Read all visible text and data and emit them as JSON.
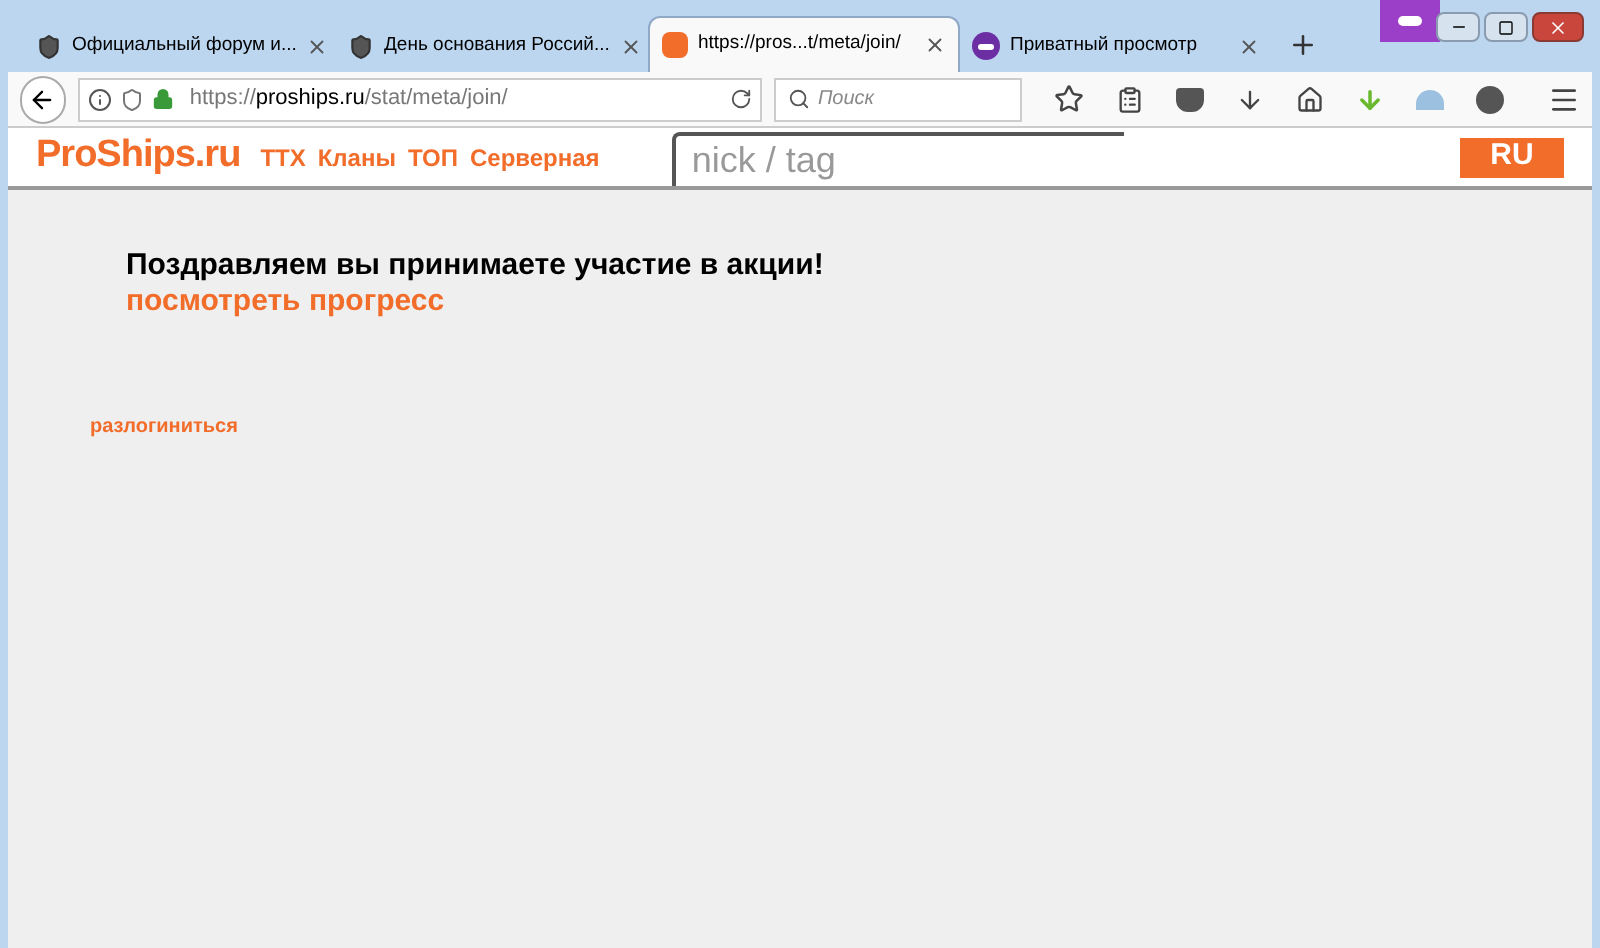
{
  "tabs": [
    {
      "title": "Официальный форум и...",
      "selected": false
    },
    {
      "title": "День основания Россий...",
      "selected": false
    },
    {
      "title": "https://pros...t/meta/join/",
      "selected": true
    },
    {
      "title": "Приватный просмотр",
      "selected": false
    }
  ],
  "address": {
    "prefix": "https://",
    "domain": "proships.ru",
    "path": "/stat/meta/join/"
  },
  "search": {
    "placeholder": "Поиск"
  },
  "site": {
    "logo": "ProShips.ru",
    "nav": [
      "ТТХ",
      "Кланы",
      "ТОП",
      "Серверная"
    ],
    "search_placeholder": "nick / tag",
    "lang": "RU"
  },
  "content": {
    "message": "Поздравляем вы принимаете участие в акции!",
    "progress_link": "посмотреть прогресс",
    "logout_link": "разлогиниться"
  }
}
